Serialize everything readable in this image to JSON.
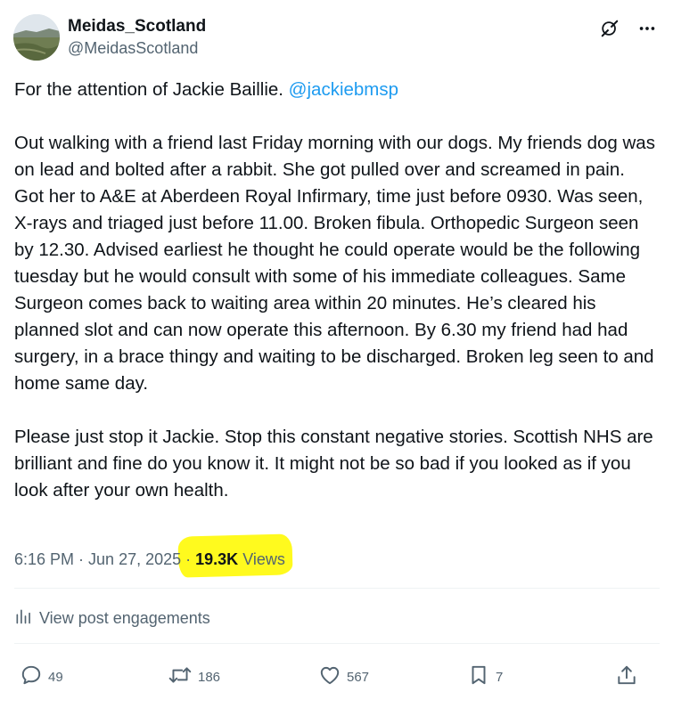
{
  "author": {
    "display_name": "Meidas_Scotland",
    "handle": "@MeidasScotland",
    "avatar_icon": "avatar-image"
  },
  "header_icons": [
    "grok-icon",
    "more-icon"
  ],
  "post": {
    "line1_prefix": "For the attention of Jackie Baillie. ",
    "mention": "@jackiebmsp",
    "paragraph2": "Out walking with a friend last Friday morning with our dogs. My friends dog was on lead and bolted after a rabbit. She got pulled over and screamed in pain. Got her to A&E at Aberdeen Royal Infirmary, time just before 0930. Was seen, X-rays and triaged just before 11.00. Broken fibula. Orthopedic Surgeon seen by 12.30. Advised earliest he thought he could operate would be the following tuesday but he would consult with some of his immediate colleagues. Same Surgeon comes back to waiting area within 20 minutes. He’s cleared his planned slot and can now operate this afternoon. By 6.30 my friend had had surgery, in a brace thingy and waiting to be discharged. Broken leg seen to and home same day.",
    "paragraph3": "Please just stop it Jackie. Stop this constant negative stories. Scottish NHS are brilliant and fine do you know it. It might not be so bad if you looked as if you look after your own health."
  },
  "meta": {
    "time": "6:16 PM",
    "sep1": " · ",
    "date": "Jun 27, 2025",
    "sep2": " · ",
    "views_count": "19.3K",
    "views_label": " Views",
    "highlight_color": "#fffa1e"
  },
  "engagements": {
    "label": "View post engagements",
    "icon": "analytics-icon"
  },
  "actions": {
    "replies": "49",
    "reposts": "186",
    "likes": "567",
    "bookmarks": "7"
  },
  "colors": {
    "text": "#0f1419",
    "secondary": "#536471",
    "link": "#1d9bf0",
    "divider": "#eff3f4"
  }
}
